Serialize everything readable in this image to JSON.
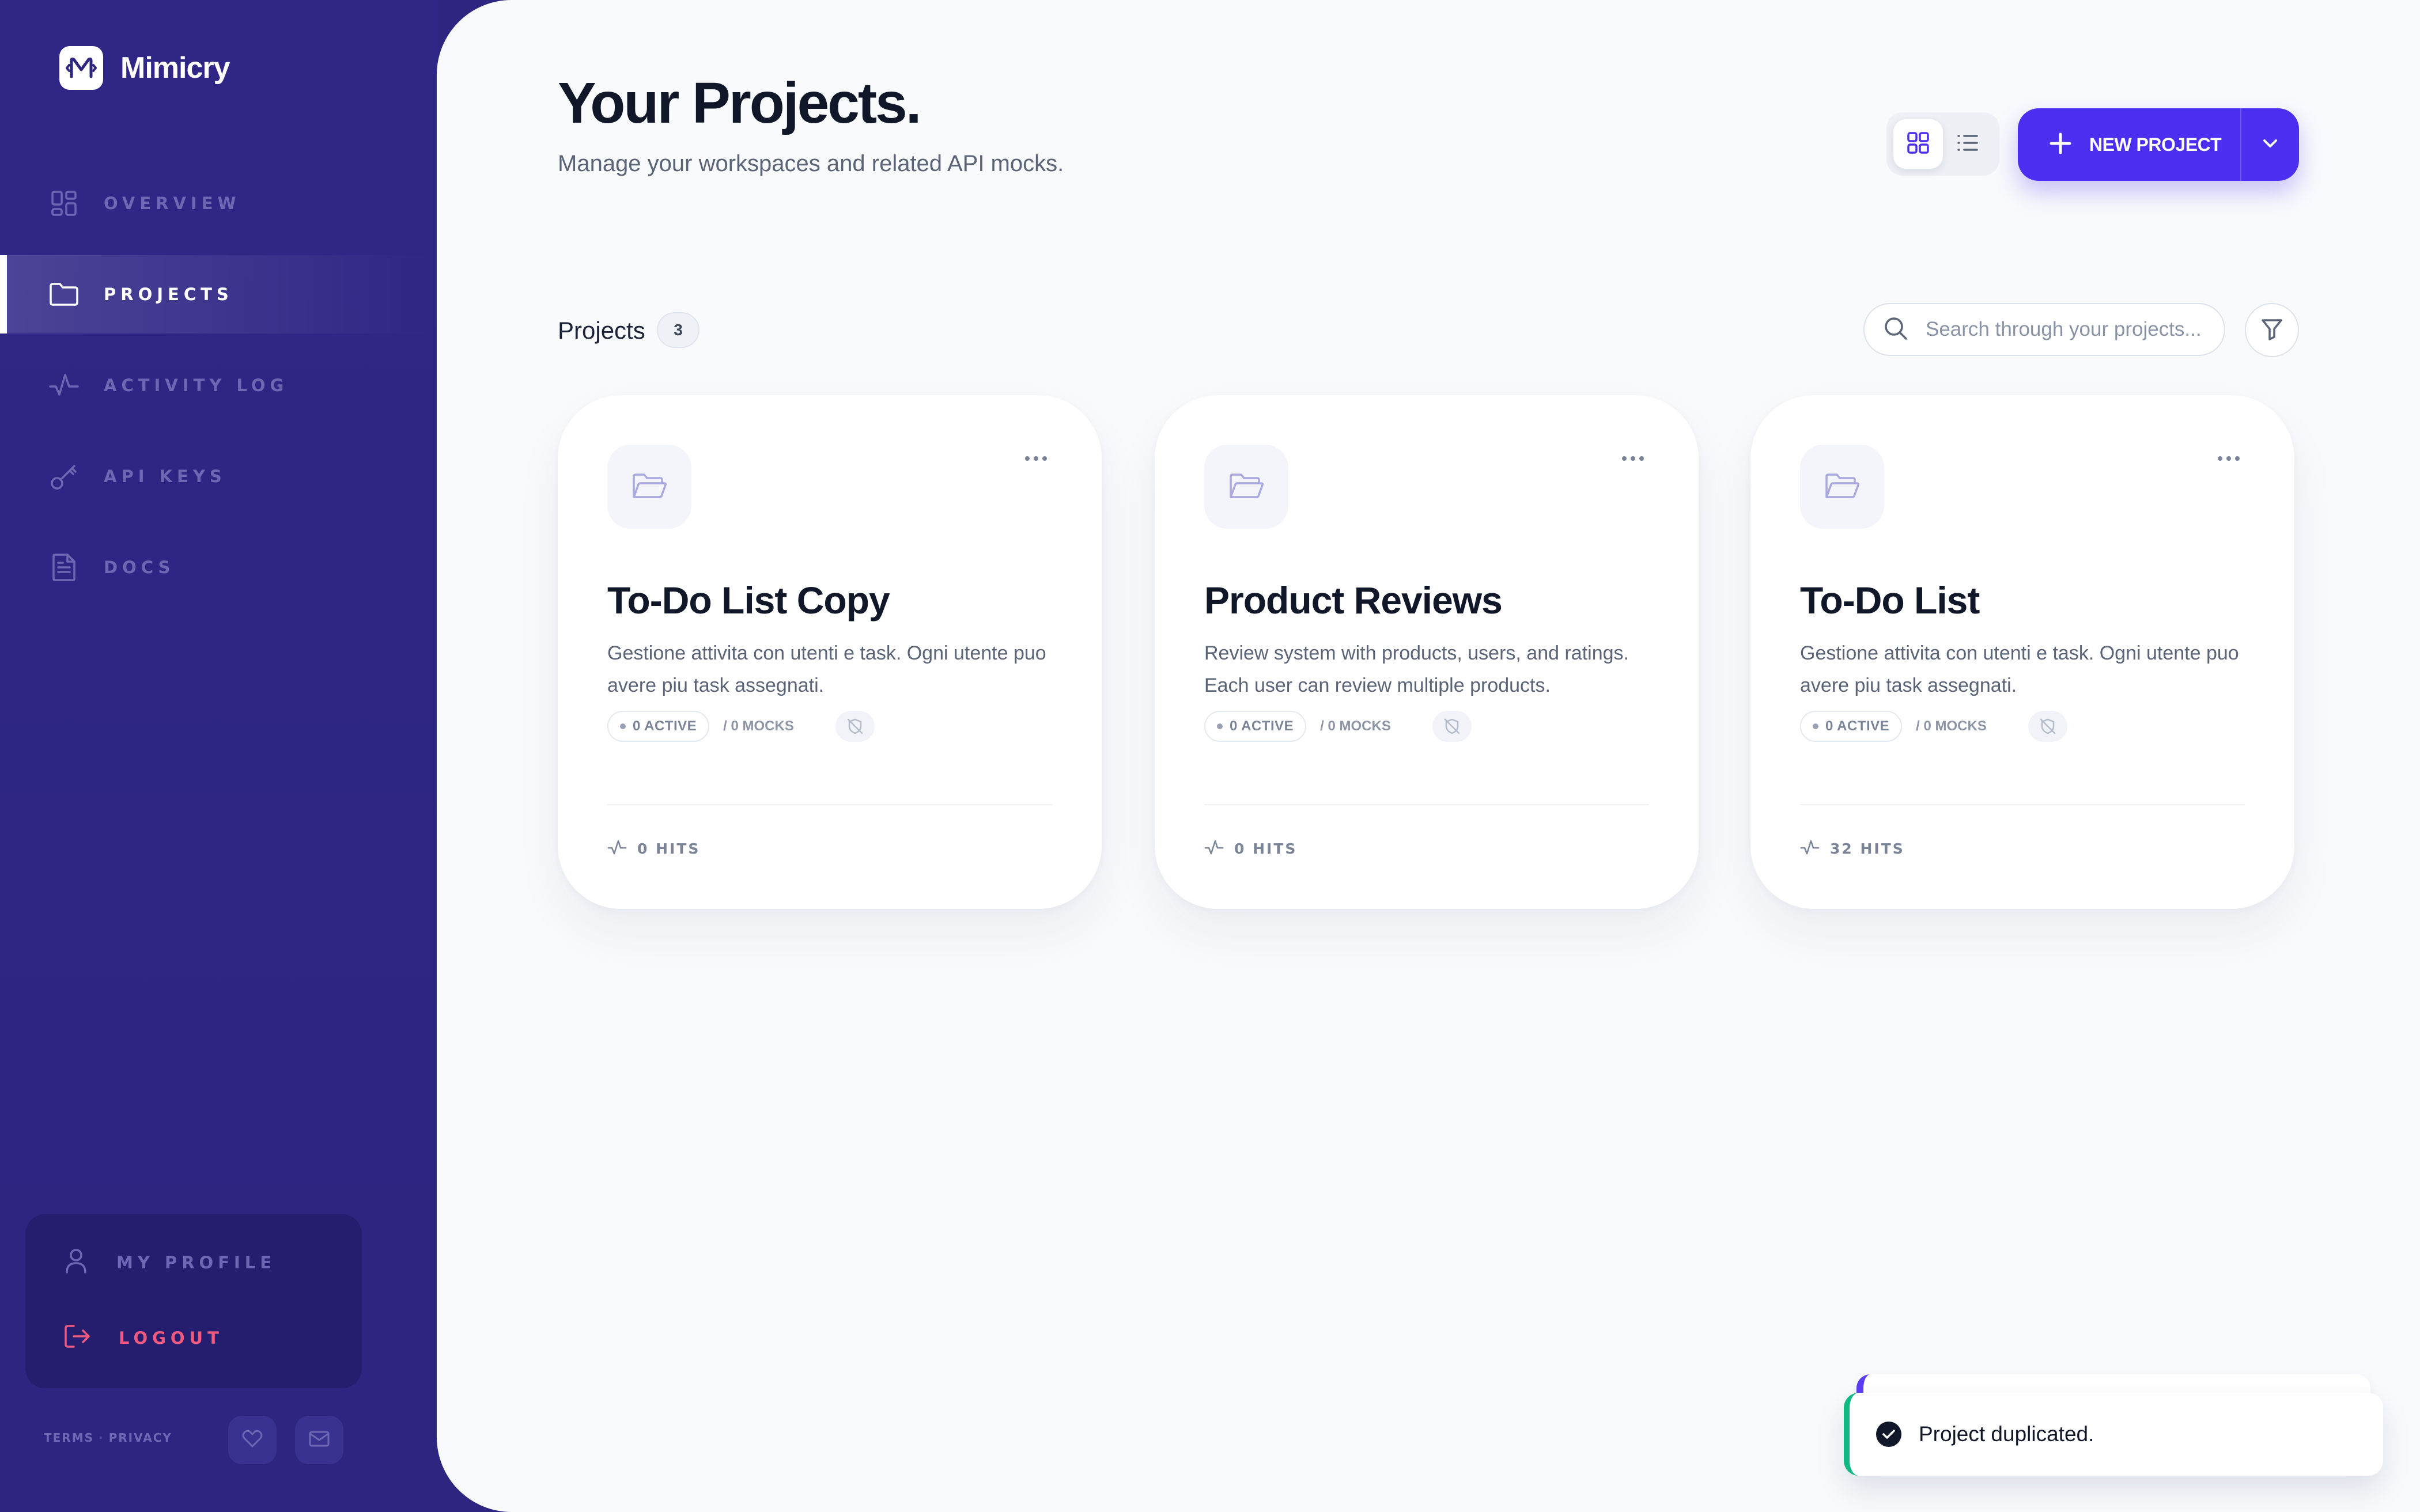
{
  "app": {
    "name": "Mimicry"
  },
  "sidebar": {
    "items": [
      {
        "label": "OVERVIEW",
        "icon": "grid-icon",
        "active": false
      },
      {
        "label": "PROJECTS",
        "icon": "folder-icon",
        "active": true
      },
      {
        "label": "ACTIVITY LOG",
        "icon": "activity-icon",
        "active": false
      },
      {
        "label": "API KEYS",
        "icon": "key-icon",
        "active": false
      },
      {
        "label": "DOCS",
        "icon": "document-icon",
        "active": false
      }
    ],
    "profile": {
      "label": "MY PROFILE",
      "icon": "user-icon"
    },
    "logout": {
      "label": "LOGOUT",
      "icon": "logout-icon",
      "color": "#f05a7e"
    },
    "footer": {
      "terms": "TERMS",
      "separator": "·",
      "privacy": "PRIVACY"
    }
  },
  "header": {
    "title": "Your Projects.",
    "subtitle": "Manage your workspaces and related API mocks.",
    "view_mode": "grid",
    "new_project_label": "NEW PROJECT"
  },
  "projects_section": {
    "label": "Projects",
    "count": "3",
    "search_placeholder": "Search through your projects..."
  },
  "cards": [
    {
      "title": "To-Do List Copy",
      "description": "Gestione attivita con utenti e task. Ogni utente puo avere piu task assegnati.",
      "active": "0 ACTIVE",
      "mocks": "/ 0 MOCKS",
      "hits": "0 HITS"
    },
    {
      "title": "Product Reviews",
      "description": "Review system with products, users, and ratings. Each user can review multiple products.",
      "active": "0 ACTIVE",
      "mocks": "/ 0 MOCKS",
      "hits": "0 HITS"
    },
    {
      "title": "To-Do List",
      "description": "Gestione attivita con utenti e task. Ogni utente puo avere piu task assegnati.",
      "active": "0 ACTIVE",
      "mocks": "/ 0 MOCKS",
      "hits": "32 HITS"
    }
  ],
  "toast": {
    "message": "Project duplicated.",
    "status": "success"
  },
  "colors": {
    "sidebar_bg": "#2e2580",
    "accent": "#4a2ff0",
    "success": "#10b981",
    "danger": "#f05a7e"
  }
}
